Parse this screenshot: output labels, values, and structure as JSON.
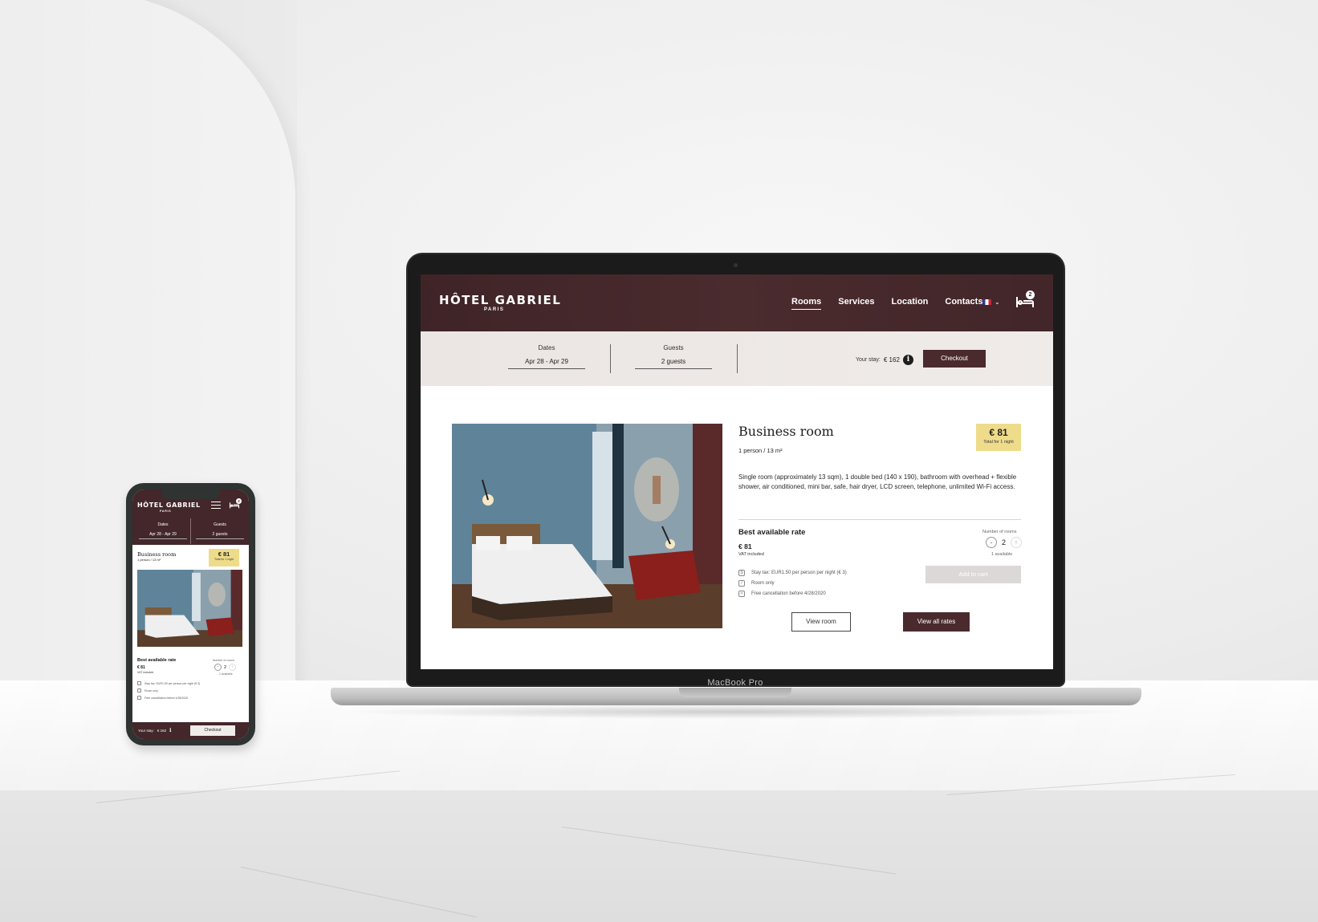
{
  "laptop": {
    "brand_label": "MacBook Pro"
  },
  "site": {
    "logo": "HÔTEL GABRIEL",
    "logo_sub": "PARIS",
    "nav": [
      {
        "label": "Rooms",
        "active": true
      },
      {
        "label": "Services",
        "active": false
      },
      {
        "label": "Location",
        "active": false
      },
      {
        "label": "Contacts",
        "active": false
      }
    ],
    "cart_count": "2",
    "booking": {
      "dates_label": "Dates",
      "dates_value": "Apr 28 - Apr 29",
      "guests_label": "Guests",
      "guests_value": "2 guests",
      "stay_label": "Your stay:",
      "stay_value": "€ 162",
      "checkout_label": "Checkout"
    },
    "room": {
      "title": "Business room",
      "subtitle": "1 person / 13 m²",
      "price": "€ 81",
      "price_note": "Total for 1 night",
      "description": "Single room (approximately 13 sqm), 1 double bed (140 x 190), bathroom with overhead + flexible shower, air conditioned, mini bar, safe, hair dryer, LCD screen, telephone, unlimited Wi-Fi access.",
      "rate_title": "Best available rate",
      "rate_price": "€ 81",
      "rate_vat": "VAT included",
      "rooms_label": "Number of rooms",
      "rooms_value": "2",
      "rooms_available": "1 available",
      "conditions": [
        {
          "icon": "tax-icon",
          "text": "Stay tax: EUR1.50 per person per night (€ 3)"
        },
        {
          "icon": "no-meal-icon",
          "text": "Room only"
        },
        {
          "icon": "calendar-icon",
          "text": "Free cancellation before 4/28/2020"
        }
      ],
      "add_to_cart": "Add to cart",
      "view_room": "View room",
      "view_all_rates": "View all rates"
    }
  },
  "colors": {
    "brand": "#4a2a2d",
    "price_highlight": "#eedc8a",
    "booking_bar": "#ece7e4"
  }
}
